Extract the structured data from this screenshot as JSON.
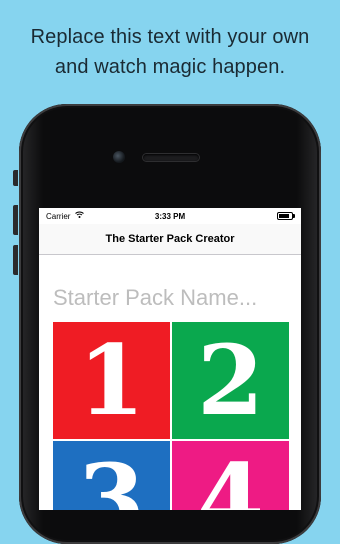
{
  "headline": {
    "line1": "Replace this text with your own",
    "line2": "and watch magic happen."
  },
  "status_bar": {
    "carrier": "Carrier",
    "wifi_icon": "wifi-icon",
    "time": "3:33 PM",
    "battery_icon": "battery-icon"
  },
  "nav": {
    "title": "The Starter Pack Creator"
  },
  "pack_name": {
    "placeholder": "Starter Pack Name...",
    "value": ""
  },
  "tiles": [
    {
      "number": "1",
      "color": "#ef1c24"
    },
    {
      "number": "2",
      "color": "#0aa84e"
    },
    {
      "number": "3",
      "color": "#1e6fc1"
    },
    {
      "number": "4",
      "color": "#ee1b84"
    }
  ]
}
